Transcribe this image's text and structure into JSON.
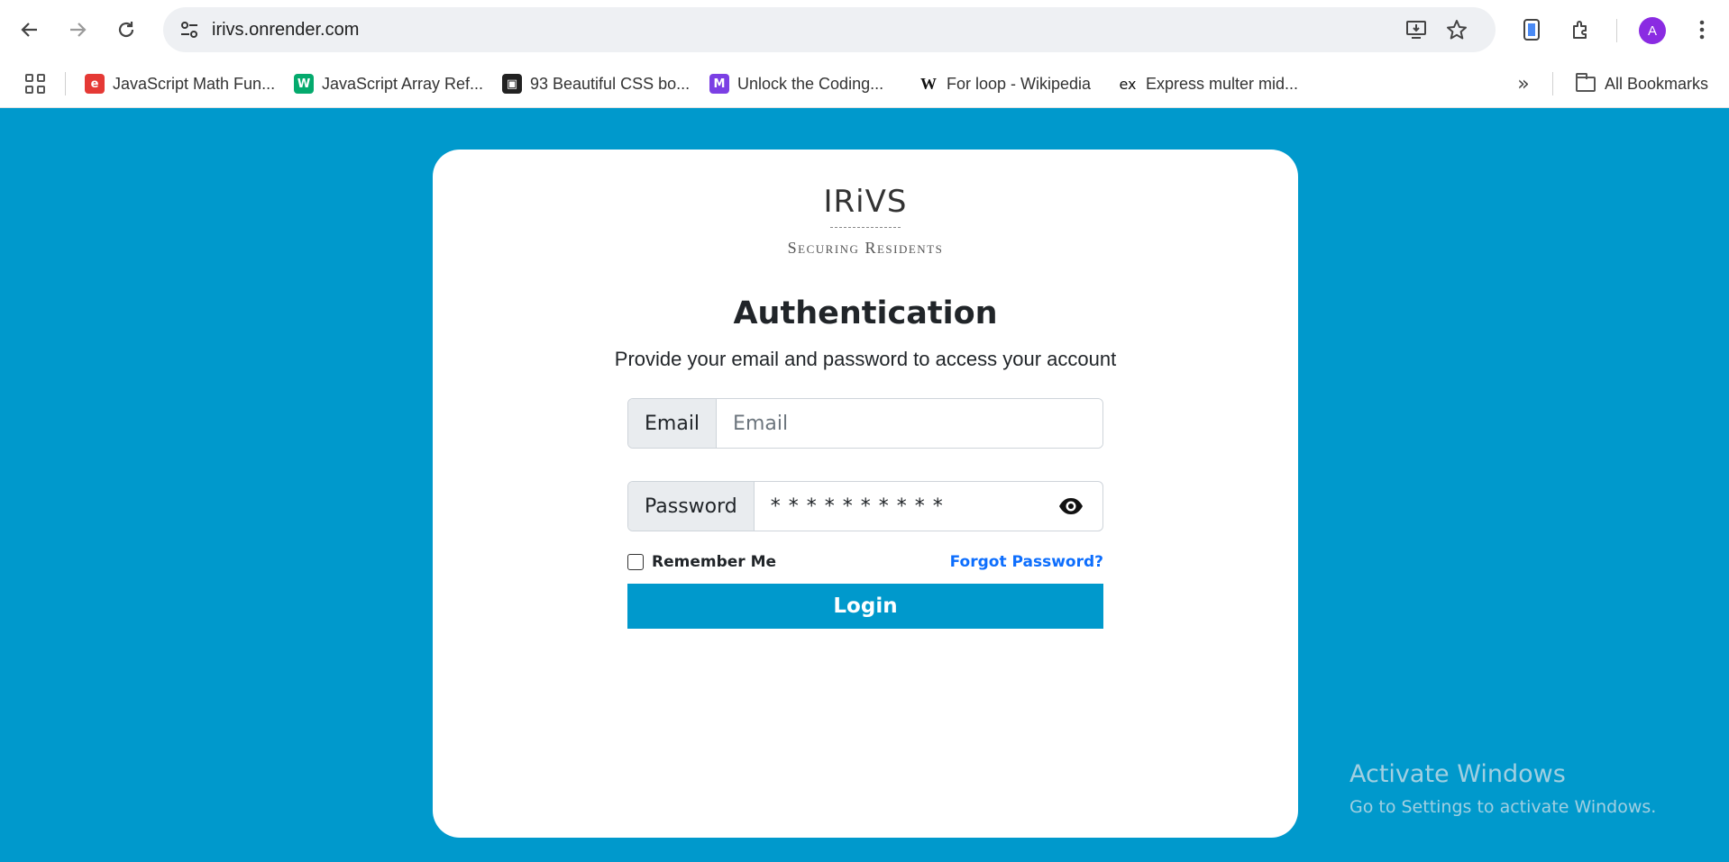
{
  "browser": {
    "url": "irivs.onrender.com",
    "avatar_letter": "A",
    "icons": [
      "back-icon",
      "forward-icon",
      "reload-icon",
      "site-info-icon",
      "install-icon",
      "star-icon",
      "side-panel-icon",
      "extensions-icon",
      "more-icon"
    ]
  },
  "bookmarks": {
    "items": [
      {
        "label": "JavaScript Math Fun...",
        "icon": "e",
        "color": "#e53935"
      },
      {
        "label": "JavaScript Array Ref...",
        "icon": "W",
        "color": "#04aa6d"
      },
      {
        "label": "93 Beautiful CSS bo...",
        "icon": "▣",
        "color": "#222222"
      },
      {
        "label": "Unlock the Coding...",
        "icon": "M",
        "color": "#7b3fe4"
      },
      {
        "label": "For loop - Wikipedia",
        "icon": "W",
        "color": "#ffffff"
      },
      {
        "label": "Express multer mid...",
        "icon": "ex",
        "color": "#ffffff"
      }
    ],
    "more": "»",
    "all_label": "All Bookmarks"
  },
  "login": {
    "logo_word": "IRiVS",
    "logo_tagline": "Securing Residents",
    "title": "Authentication",
    "subtitle": "Provide your email and password to access your account",
    "email_label": "Email",
    "email_placeholder": "Email",
    "password_label": "Password",
    "password_value": "* * * * * * * * * *",
    "remember_label": "Remember Me",
    "forgot_label": "Forgot Password?",
    "login_label": "Login",
    "accent_color": "#0099cc"
  },
  "watermark": {
    "line1": "Activate Windows",
    "line2": "Go to Settings to activate Windows."
  }
}
